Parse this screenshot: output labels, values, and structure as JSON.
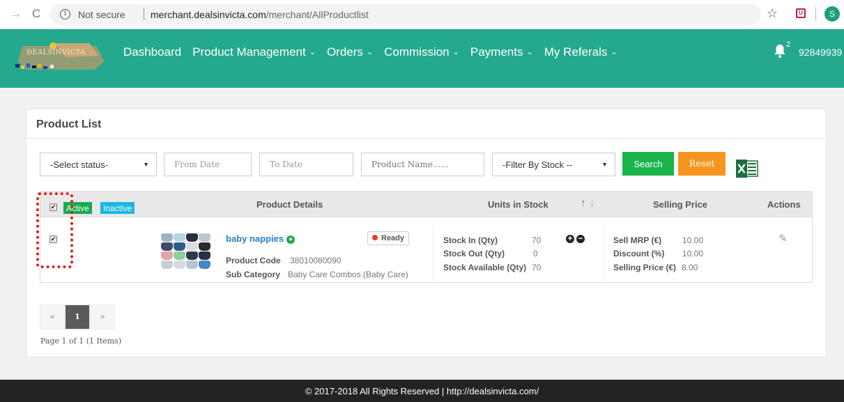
{
  "browser": {
    "secure_label": "Not secure",
    "url_host": "merchant.dealsinvicta.com",
    "url_path": "/merchant/AllProductlist",
    "profile_initial": "S"
  },
  "header": {
    "logo_text": "DEALSINVICTA",
    "nav": [
      "Dashboard",
      "Product Management",
      "Orders",
      "Commission",
      "Payments",
      "My Referals"
    ],
    "notification_count": "2",
    "user_id": "92849939"
  },
  "panel": {
    "title": "Product List"
  },
  "filters": {
    "status": "-Select status-",
    "from_date": "From Date",
    "to_date": "To Date",
    "product_name": "Product Name......",
    "stock": "-Filter By Stock --",
    "search_label": "Search",
    "reset_label": "Reset"
  },
  "table": {
    "tag_active": "Active",
    "tag_inactive": "Inactive",
    "headers": {
      "product_details": "Product Details",
      "units_in_stock": "Units in Stock",
      "selling_price": "Selling Price",
      "actions": "Actions"
    },
    "rows": [
      {
        "name": "baby nappies",
        "status": "Ready",
        "product_code_label": "Product Code",
        "product_code": "38010080090",
        "sub_category_label": "Sub Category",
        "sub_category": "Baby Care Combos (Baby Care)",
        "stock_in_label": "Stock In (Qty)",
        "stock_in": "70",
        "stock_out_label": "Stock Out (Qty)",
        "stock_out": "0",
        "stock_available_label": "Stock Available (Qty)",
        "stock_available": "70",
        "mrp_label": "Sell MRP (€)",
        "mrp": "10.00",
        "discount_label": "Discount (%)",
        "discount": "10.00",
        "selling_price_label": "Selling Price (€)",
        "selling_price": "8.00"
      }
    ]
  },
  "pagination": {
    "prev": "«",
    "current": "1",
    "next": "»",
    "info": "Page 1 of 1 (1 Items)"
  },
  "footer": {
    "text": "© 2017-2018 All Rights Reserved | http://dealsinvicta.com/"
  },
  "colors": {
    "header_bg": "#24a98e",
    "search_btn": "#1cb34a",
    "reset_btn": "#f7941d",
    "active_tag": "#1aa94f",
    "inactive_tag": "#19b7e4",
    "product_link": "#2a7fc4",
    "annotation_dashes": "#e01b1b"
  },
  "icons": {
    "info": "info-icon",
    "star": "bookmark-star-icon",
    "bell": "bell-icon",
    "excel": "excel-export-icon",
    "plus": "plus-circle-icon",
    "minus": "minus-circle-icon",
    "edit": "pencil-icon"
  }
}
